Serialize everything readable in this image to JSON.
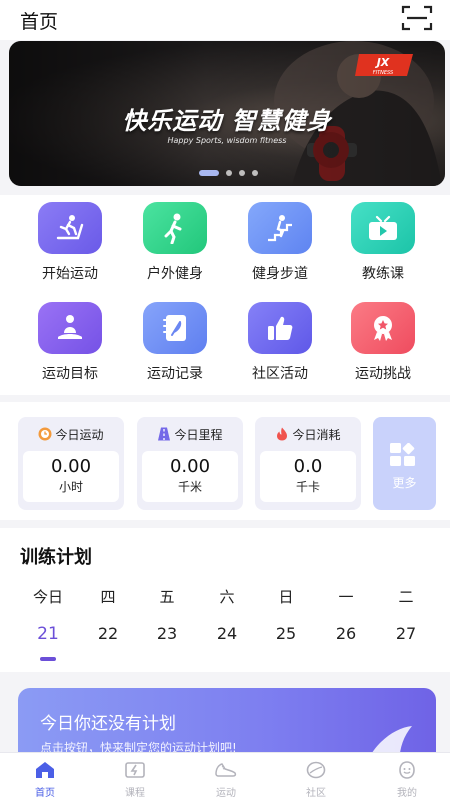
{
  "header": {
    "title": "首页",
    "scan_icon": "scan-icon"
  },
  "banner": {
    "headline": "快乐运动  智慧健身",
    "subtitle": "Happy Sports, wisdom fitness",
    "logo_text": "JX",
    "logo_sub": "FITNESS",
    "slide_count": 4,
    "active_slide": 1
  },
  "shortcuts": [
    {
      "label": "开始运动",
      "icon": "treadmill-icon",
      "color": "#7a6cf2"
    },
    {
      "label": "户外健身",
      "icon": "runner-icon",
      "color": "#34d58e"
    },
    {
      "label": "健身步道",
      "icon": "stairs-icon",
      "color": "#6f95f6"
    },
    {
      "label": "教练课",
      "icon": "tv-icon",
      "color": "#2fd1b8"
    },
    {
      "label": "运动目标",
      "icon": "meditation-icon",
      "color": "#8a63f0"
    },
    {
      "label": "运动记录",
      "icon": "notebook-icon",
      "color": "#6f8ef5"
    },
    {
      "label": "社区活动",
      "icon": "thumbs-up-icon",
      "color": "#6d6cf2"
    },
    {
      "label": "运动挑战",
      "icon": "medal-icon",
      "color": "#f45b6b"
    }
  ],
  "stats": {
    "cards": [
      {
        "title": "今日运动",
        "value": "0.00",
        "unit": "小时",
        "icon": "clock-icon"
      },
      {
        "title": "今日里程",
        "value": "0.00",
        "unit": "千米",
        "icon": "road-icon"
      },
      {
        "title": "今日消耗",
        "value": "0.0",
        "unit": "千卡",
        "icon": "flame-icon"
      }
    ],
    "more_label": "更多"
  },
  "plan": {
    "title": "训练计划",
    "days": [
      {
        "weekday": "今日",
        "date": "21",
        "today": true
      },
      {
        "weekday": "四",
        "date": "22"
      },
      {
        "weekday": "五",
        "date": "23"
      },
      {
        "weekday": "六",
        "date": "24"
      },
      {
        "weekday": "日",
        "date": "25"
      },
      {
        "weekday": "一",
        "date": "26"
      },
      {
        "weekday": "二",
        "date": "27"
      }
    ]
  },
  "promo": {
    "title": "今日你还没有计划",
    "subtitle": "点击按钮，快来制定您的运动计划吧!"
  },
  "tabbar": [
    {
      "label": "首页",
      "icon": "home-icon",
      "active": true
    },
    {
      "label": "课程",
      "icon": "course-icon"
    },
    {
      "label": "运动",
      "icon": "sneaker-icon"
    },
    {
      "label": "社区",
      "icon": "community-icon"
    },
    {
      "label": "我的",
      "icon": "profile-icon"
    }
  ],
  "colors": {
    "accent": "#6b4fd8",
    "tab_active": "#4b5fe6",
    "tab_inactive": "#b3b3bb"
  }
}
